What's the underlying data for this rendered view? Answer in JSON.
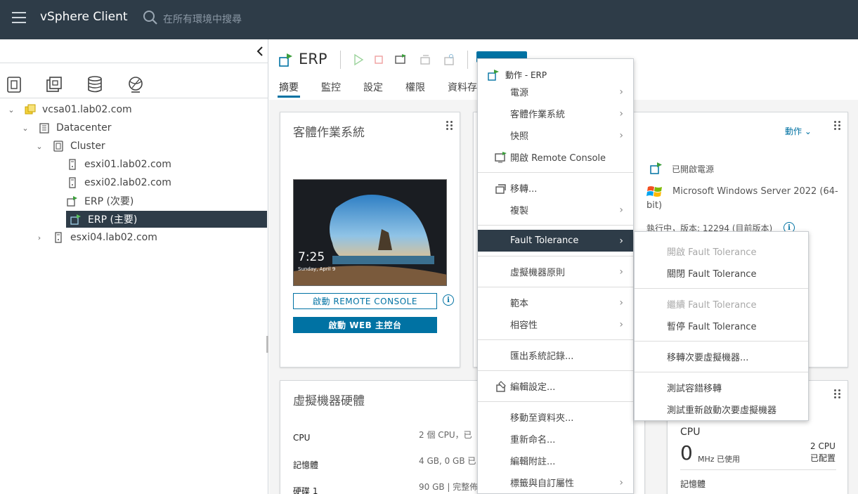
{
  "header": {
    "app_title": "vSphere Client",
    "search_placeholder": "在所有環境中搜尋"
  },
  "leftnav": {
    "tree": [
      {
        "label": "vcsa01.lab02.com",
        "expanded": true
      },
      {
        "label": "Datacenter",
        "expanded": true
      },
      {
        "label": "Cluster",
        "expanded": true
      },
      {
        "label": "esxi01.lab02.com"
      },
      {
        "label": "esxi02.lab02.com"
      },
      {
        "label": "ERP (次要)"
      },
      {
        "label": "ERP (主要)",
        "selected": true
      },
      {
        "label": "esxi04.lab02.com",
        "expanded": false
      }
    ]
  },
  "object": {
    "title": "ERP",
    "tabs": [
      "摘要",
      "監控",
      "設定",
      "權限",
      "資料存"
    ]
  },
  "guest_card": {
    "title": "客體作業系統",
    "clock": "7:25",
    "date": "Sunday, April 9",
    "rc_button": "啟動 REMOTE CONSOLE",
    "web_button": "啟動 WEB 主控台"
  },
  "summary_card": {
    "actions_label": "動作 ⌄",
    "power_state": "已開啟電源",
    "os_line1": "Microsoft Windows Server 2022 (64-",
    "os_line2": "bit)",
    "version": "執行中，版本: 12294 (目前版本)"
  },
  "hw_card": {
    "title": "虛擬機器硬體",
    "rows": [
      {
        "label": "CPU",
        "value": "2 個 CPU，已"
      },
      {
        "label": "記憶體",
        "value": "4 GB, 0 GB 已"
      },
      {
        "label": "硬碟 1",
        "value": "90 GB | 完整佈"
      }
    ]
  },
  "usage_card": {
    "cpu_label": "CPU",
    "cpu_value": "0",
    "cpu_unit": "MHz 已使用",
    "cpu_alloc1": "2 CPU",
    "cpu_alloc2": "已配置",
    "mem_label": "記憶體"
  },
  "context_menu": {
    "header": "動作 - ERP",
    "items": [
      {
        "label": "電源",
        "submenu": true
      },
      {
        "label": "客體作業系統",
        "submenu": true
      },
      {
        "label": "快照",
        "submenu": true
      },
      {
        "label": "開啟 Remote Console",
        "icon": "remote-console-icon"
      },
      {
        "label": "移轉...",
        "icon": "migrate-icon"
      },
      {
        "label": "複製",
        "submenu": true
      },
      {
        "label": "Fault Tolerance",
        "submenu": true,
        "highlighted": true
      },
      {
        "label": "虛擬機器原則",
        "submenu": true
      },
      {
        "label": "範本",
        "submenu": true
      },
      {
        "label": "相容性",
        "submenu": true
      },
      {
        "label": "匯出系統記錄..."
      },
      {
        "label": "編輯設定...",
        "icon": "edit-settings-icon"
      },
      {
        "label": "移動至資料夾..."
      },
      {
        "label": "重新命名..."
      },
      {
        "label": "編輯附註..."
      },
      {
        "label": "標籤與自訂屬性",
        "submenu": true
      }
    ]
  },
  "ft_submenu": {
    "items": [
      {
        "label": "開啟 Fault Tolerance",
        "disabled": true
      },
      {
        "label": "關閉 Fault Tolerance"
      },
      {
        "label": "繼續 Fault Tolerance",
        "disabled": true
      },
      {
        "label": "暫停 Fault Tolerance"
      },
      {
        "label": "移轉次要虛擬機器..."
      },
      {
        "label": "測試容錯移轉"
      },
      {
        "label": "測試重新啟動次要虛擬機器"
      }
    ]
  },
  "colors": {
    "header_bg": "#2e3c48",
    "accent": "#0072a3",
    "selected_bg": "#2e3c48"
  }
}
